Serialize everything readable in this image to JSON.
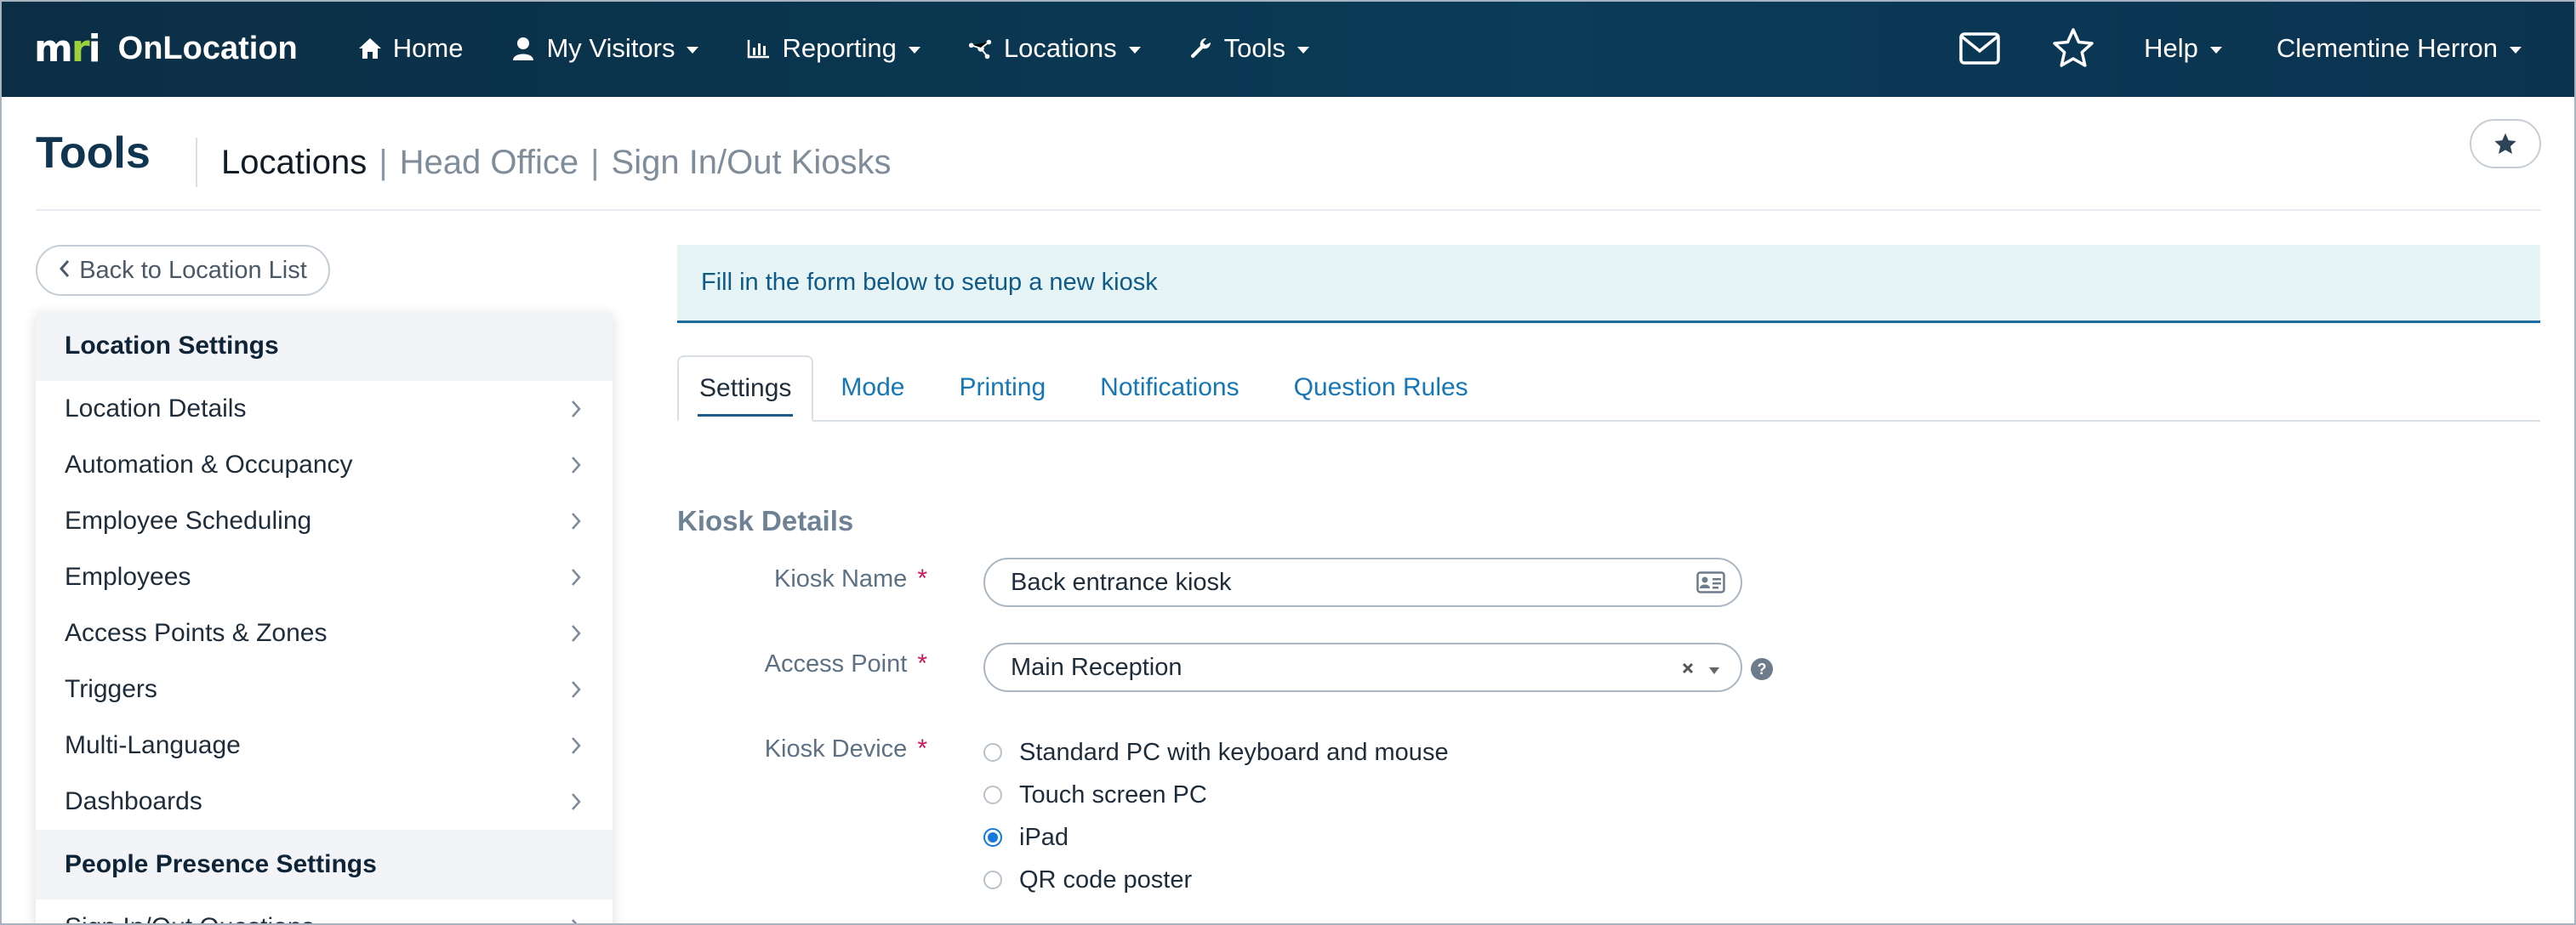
{
  "navbar": {
    "brand_logo_text": "mri",
    "brand_name": "OnLocation",
    "items": [
      {
        "label": "Home",
        "icon": "home-icon",
        "has_caret": false
      },
      {
        "label": "My Visitors",
        "icon": "user-icon",
        "has_caret": true
      },
      {
        "label": "Reporting",
        "icon": "bar-chart-icon",
        "has_caret": true
      },
      {
        "label": "Locations",
        "icon": "network-icon",
        "has_caret": true
      },
      {
        "label": "Tools",
        "icon": "wrench-icon",
        "has_caret": true
      }
    ],
    "right": {
      "mail_icon": "envelope-icon",
      "favorite_icon": "star-outline-icon",
      "help_label": "Help",
      "user_label": "Clementine Herron"
    }
  },
  "header": {
    "title": "Tools",
    "breadcrumb": {
      "current": "Locations",
      "separator": "|",
      "items": [
        "Head Office",
        "Sign In/Out Kiosks"
      ]
    },
    "favorite_icon": "star-solid-icon"
  },
  "sidebar": {
    "back_label": "Back to Location List",
    "sections": [
      {
        "title": "Location Settings",
        "items": [
          "Location Details",
          "Automation & Occupancy",
          "Employee Scheduling",
          "Employees",
          "Access Points & Zones",
          "Triggers",
          "Multi-Language",
          "Dashboards"
        ]
      },
      {
        "title": "People Presence Settings",
        "items": [
          "Sign In/Out Questions"
        ]
      }
    ]
  },
  "main": {
    "info_text": "Fill in the form below to setup a new kiosk",
    "tabs": [
      "Settings",
      "Mode",
      "Printing",
      "Notifications",
      "Question Rules"
    ],
    "active_tab": "Settings",
    "section_title": "Kiosk Details",
    "fields": {
      "kiosk_name": {
        "label": "Kiosk Name",
        "value": "Back entrance kiosk",
        "required": "*"
      },
      "access_point": {
        "label": "Access Point",
        "value": "Main Reception",
        "required": "*",
        "help": "?"
      },
      "kiosk_device": {
        "label": "Kiosk Device",
        "required": "*",
        "options": [
          "Standard PC with keyboard and mouse",
          "Touch screen PC",
          "iPad",
          "QR code poster"
        ],
        "selected": "iPad"
      }
    }
  },
  "colors": {
    "nav_bg": "#0b2e45",
    "accent": "#1677b6",
    "required": "#d4145a",
    "radio_selected": "#1479dc"
  }
}
